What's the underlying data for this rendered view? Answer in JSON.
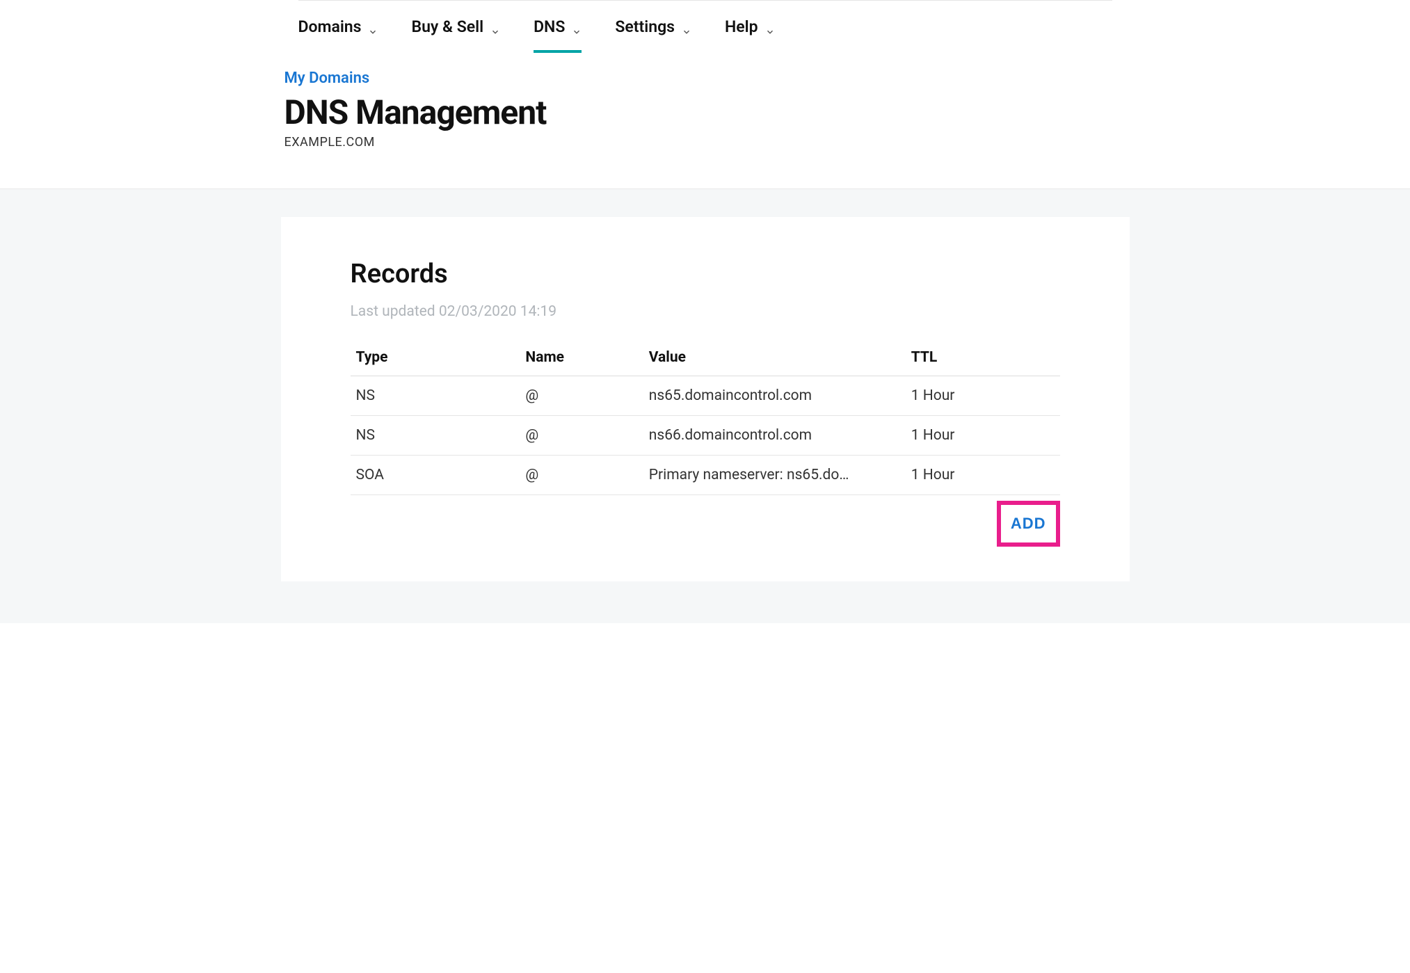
{
  "nav": {
    "tabs": [
      {
        "label": "Domains",
        "active": false
      },
      {
        "label": "Buy & Sell",
        "active": false
      },
      {
        "label": "DNS",
        "active": true
      },
      {
        "label": "Settings",
        "active": false
      },
      {
        "label": "Help",
        "active": false
      }
    ]
  },
  "breadcrumb": {
    "label": "My Domains"
  },
  "header": {
    "title": "DNS Management",
    "domain": "EXAMPLE.COM"
  },
  "records": {
    "title": "Records",
    "last_updated": "Last updated 02/03/2020 14:19",
    "columns": {
      "type": "Type",
      "name": "Name",
      "value": "Value",
      "ttl": "TTL"
    },
    "rows": [
      {
        "type": "NS",
        "name": "@",
        "value": "ns65.domaincontrol.com",
        "ttl": "1 Hour"
      },
      {
        "type": "NS",
        "name": "@",
        "value": "ns66.domaincontrol.com",
        "ttl": "1 Hour"
      },
      {
        "type": "SOA",
        "name": "@",
        "value": "Primary nameserver: ns65.do…",
        "ttl": "1 Hour"
      }
    ],
    "add_label": "ADD"
  }
}
